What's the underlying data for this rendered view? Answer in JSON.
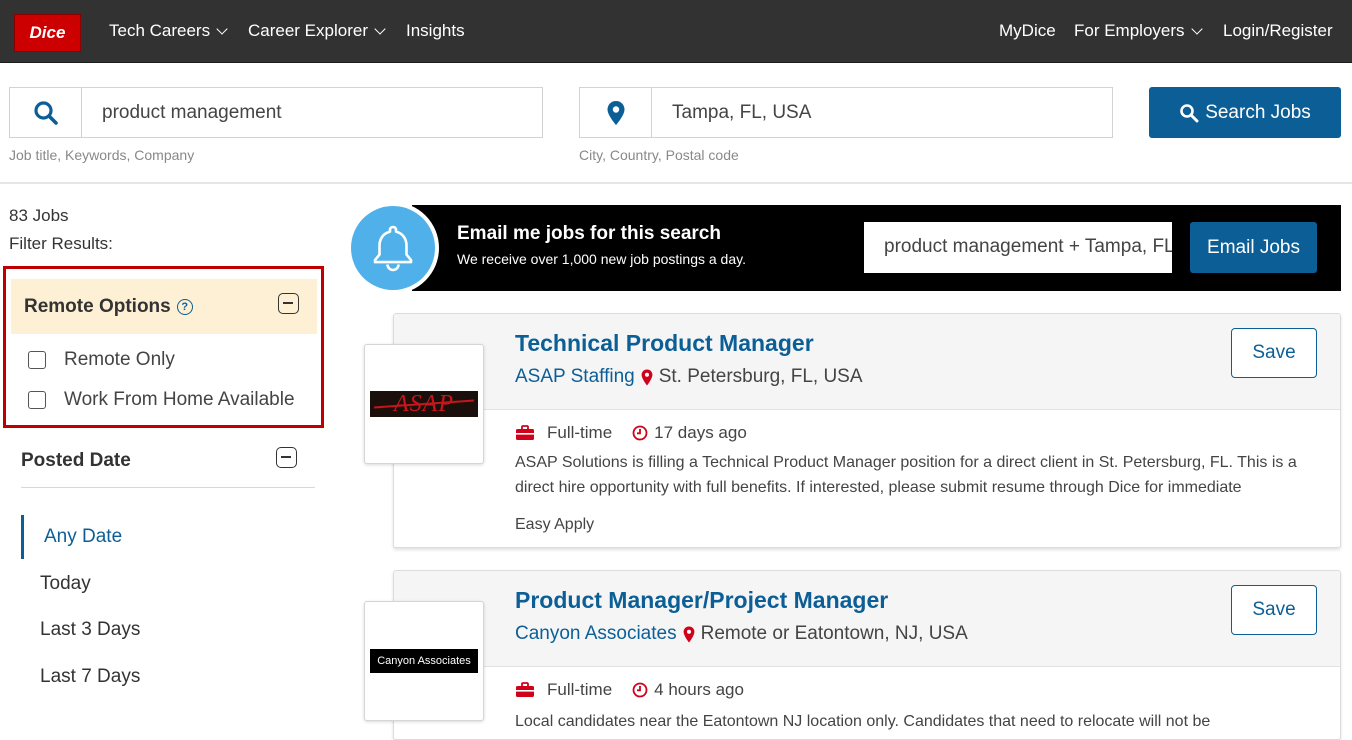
{
  "nav": {
    "logo_text": "Dice",
    "items": [
      {
        "label": "Tech Careers",
        "dropdown": true
      },
      {
        "label": "Career Explorer",
        "dropdown": true
      },
      {
        "label": "Insights",
        "dropdown": false
      }
    ],
    "right_items": [
      {
        "label": "MyDice",
        "dropdown": false
      },
      {
        "label": "For Employers",
        "dropdown": true
      },
      {
        "label": "Login/Register",
        "dropdown": false
      }
    ]
  },
  "search": {
    "keyword_value": "product management",
    "keyword_help": "Job title, Keywords, Company",
    "location_value": "Tampa, FL, USA",
    "location_help": "City, Country, Postal code",
    "button_label": "Search Jobs"
  },
  "results": {
    "count_label": "83 Jobs",
    "filter_label": "Filter Results:"
  },
  "filters": {
    "remote": {
      "title": "Remote Options",
      "options": [
        {
          "label": "Remote Only",
          "checked": false
        },
        {
          "label": "Work From Home Available",
          "checked": false
        }
      ]
    },
    "posted_date": {
      "title": "Posted Date",
      "options": [
        "Any Date",
        "Today",
        "Last 3 Days",
        "Last 7 Days"
      ],
      "selected": "Any Date"
    }
  },
  "email_banner": {
    "title": "Email me jobs for this search",
    "subtitle": "We receive over 1,000 new job postings a day.",
    "input_value": "product management + Tampa, FL, USA",
    "button_label": "Email Jobs"
  },
  "jobs": [
    {
      "title": "Technical Product Manager",
      "company": "ASAP Staffing",
      "location": "St. Petersburg, FL, USA",
      "logo_text": "ASAP",
      "employment": "Full-time",
      "posted": "17 days ago",
      "description": "ASAP Solutions is filling a Technical Product Manager position for a direct client in St. Petersburg, FL. This is a direct hire opportunity with full benefits. If interested, please submit resume through Dice for immediate",
      "easy_apply": "Easy Apply",
      "save_label": "Save"
    },
    {
      "title": "Product Manager/Project Manager",
      "company": "Canyon Associates",
      "location": "Remote or Eatontown, NJ, USA",
      "logo_text": "Canyon Associates",
      "employment": "Full-time",
      "posted": "4 hours ago",
      "description": "Local candidates near the Eatontown NJ location only. Candidates that need to relocate will not be",
      "save_label": "Save"
    }
  ],
  "colors": {
    "brand_red": "#cc0000",
    "primary_blue": "#0c5f96",
    "nav_bg": "#323232",
    "highlight_border": "#c00000",
    "filter_head_bg": "#fdf0d5",
    "bell_blue": "#4fb0ea",
    "pin_red": "#d0021b"
  }
}
